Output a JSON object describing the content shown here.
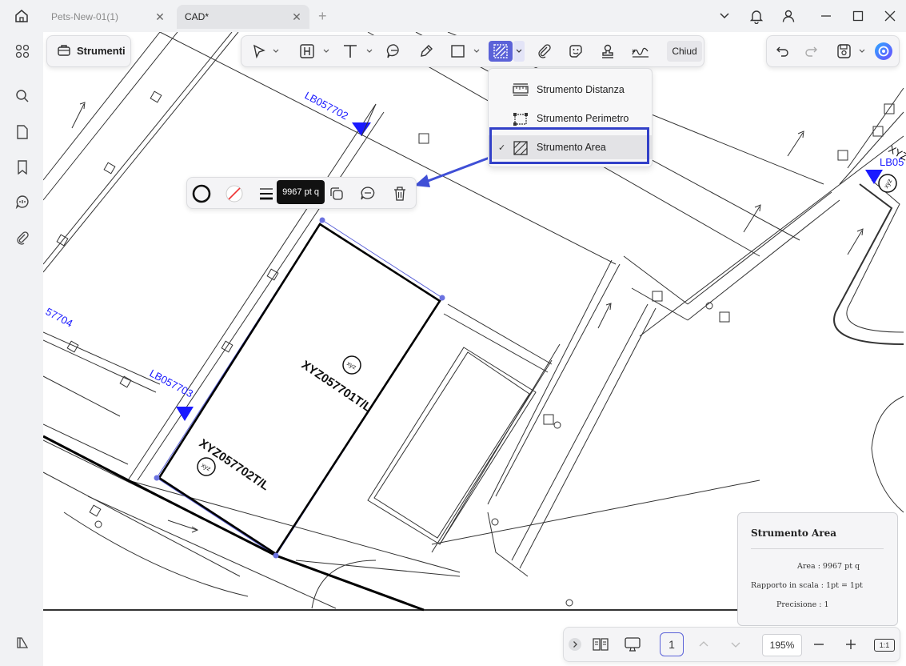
{
  "tabs": [
    {
      "label": "Pets-New-01(1)"
    },
    {
      "label": "CAD*"
    }
  ],
  "toolbar": {
    "strumenti_label": "Strumenti",
    "chiudi_label": "Chiud"
  },
  "dropdown": {
    "items": [
      {
        "label": "Strumento Distanza",
        "icon": "distance-ruler-icon"
      },
      {
        "label": "Strumento Perimetro",
        "icon": "perimeter-icon"
      },
      {
        "label": "Strumento Area",
        "icon": "area-hatch-icon",
        "checkmark": "✓",
        "selected": true
      }
    ]
  },
  "annotation": {
    "tooltip": "9967 pt q"
  },
  "drawing": {
    "labels": {
      "lb1": "LB057702",
      "lb2": "LB057703",
      "lb3": "57704",
      "lb4": "LB05",
      "lb5": "XYZ",
      "unit1": "XYZ057701T/L",
      "unit2": "XYZ057702T/L",
      "badge": "xyz"
    }
  },
  "info_panel": {
    "title": "Strumento Area",
    "area": "Area : 9967 pt q",
    "scale": "Rapporto in scala : 1pt = 1pt",
    "precision": "Precisione : 1"
  },
  "bottom": {
    "page": "1",
    "zoom": "195%",
    "fit_label": "1:1"
  },
  "colors": {
    "accent": "#5b62d8",
    "highlight_box": "#3240c8",
    "cad_blue": "#1a1aff"
  }
}
